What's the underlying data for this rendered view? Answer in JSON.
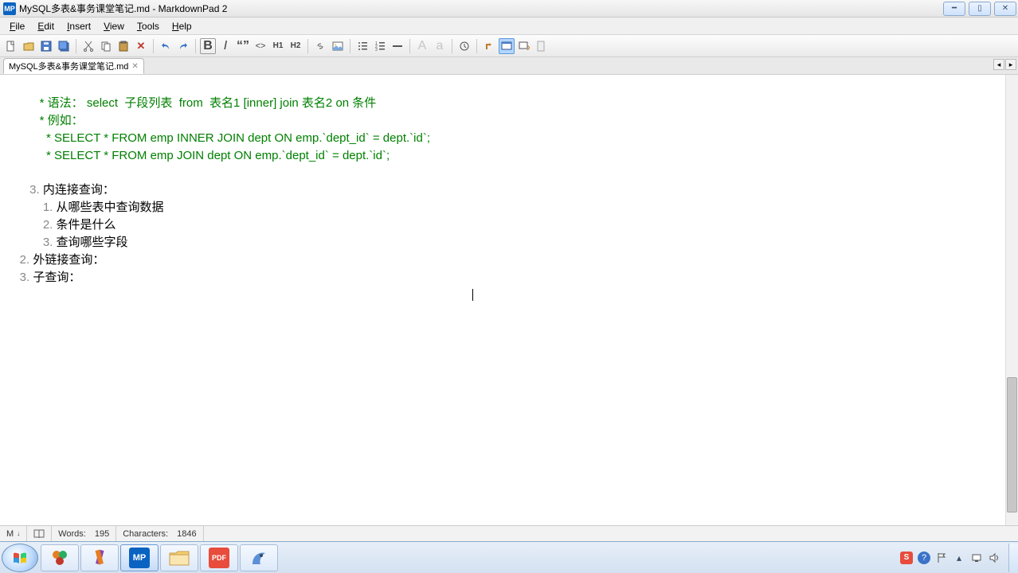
{
  "window": {
    "app_badge": "MP",
    "title": "MySQL多表&事务课堂笔记.md - MarkdownPad 2"
  },
  "menu": {
    "file": "File",
    "edit": "Edit",
    "insert": "Insert",
    "view": "View",
    "tools": "Tools",
    "help": "Help"
  },
  "tab": {
    "label": "MySQL多表&事务课堂笔记.md"
  },
  "editor": {
    "l1a": "          * 语法：",
    "l1b": " select  子段列表  from  表名1 [inner] join 表名2 on 条件",
    "l2": "          * 例如：",
    "l3": "            * SELECT * FROM emp INNER JOIN dept ON emp.`dept_id` = dept.`id`;",
    "l4": "            * SELECT * FROM emp JOIN dept ON emp.`dept_id` = dept.`id`;",
    "n3": "       3. ",
    "t3": "内连接查询：",
    "n31": "           1. ",
    "t31": "从哪些表中查询数据",
    "n32": "           2. ",
    "t32": "条件是什么",
    "n33": "           3. ",
    "t33": "查询哪些字段",
    "nB": "    2. ",
    "tB": "外链接查询：",
    "nC": "    3. ",
    "tC": "子查询："
  },
  "status": {
    "words_label": "Words:",
    "words": "195",
    "chars_label": "Characters:",
    "chars": "1846"
  },
  "tooltips": {
    "new": "new-file",
    "open": "open-file",
    "save": "save",
    "save_all": "save-all",
    "cut": "cut",
    "copy": "copy",
    "paste": "paste",
    "undo": "undo",
    "redo": "redo",
    "bold": "bold",
    "italic": "italic",
    "quote": "quote",
    "code": "code",
    "h1": "heading-1",
    "h2": "heading-2",
    "link": "hyperlink",
    "image": "image",
    "ul": "unordered-list",
    "ol": "ordered-list",
    "hr": "horizontal-rule",
    "upper": "uppercase",
    "lower": "lowercase",
    "timestamp": "timestamp",
    "livepreview": "live-preview",
    "preview": "preview-browser",
    "export": "export"
  }
}
